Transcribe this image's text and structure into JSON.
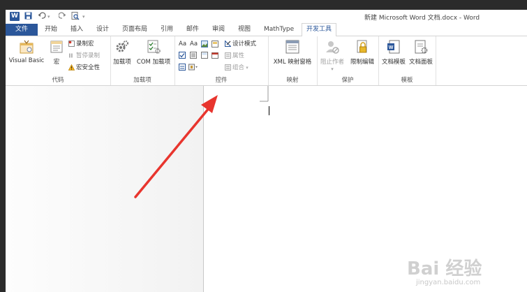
{
  "titlebar": {
    "app_logo": "W",
    "document_title": "新建 Microsoft Word 文档.docx - Word"
  },
  "tabs": [
    {
      "label": "文件"
    },
    {
      "label": "开始"
    },
    {
      "label": "插入"
    },
    {
      "label": "设计"
    },
    {
      "label": "页面布局"
    },
    {
      "label": "引用"
    },
    {
      "label": "邮件"
    },
    {
      "label": "审阅"
    },
    {
      "label": "视图"
    },
    {
      "label": "MathType"
    },
    {
      "label": "开发工具",
      "active": true
    }
  ],
  "ribbon": {
    "code": {
      "label": "代码",
      "visual_basic": "Visual Basic",
      "macros": "宏",
      "record_macro": "录制宏",
      "pause_recording": "暂停录制",
      "macro_security": "宏安全性"
    },
    "addins": {
      "label": "加载项",
      "addins": "加载项",
      "com_addins": "COM 加载项"
    },
    "controls": {
      "label": "控件",
      "text_aa_1": "Aa",
      "text_aa_2": "Aa",
      "design_mode": "设计模式",
      "properties": "属性",
      "group": "组合"
    },
    "mapping": {
      "label": "映射",
      "xml_pane": "XML 映射窗格"
    },
    "protect": {
      "label": "保护",
      "block_authors": "阻止作者",
      "restrict_editing": "限制编辑"
    },
    "templates": {
      "label": "模板",
      "document_template": "文档模板",
      "document_panel": "文档面板"
    }
  },
  "watermark": {
    "text": "Bai 经验",
    "url_text": "jingyan.baidu.com"
  },
  "colors": {
    "accent": "#2b579a",
    "arrow": "#e8352e"
  }
}
